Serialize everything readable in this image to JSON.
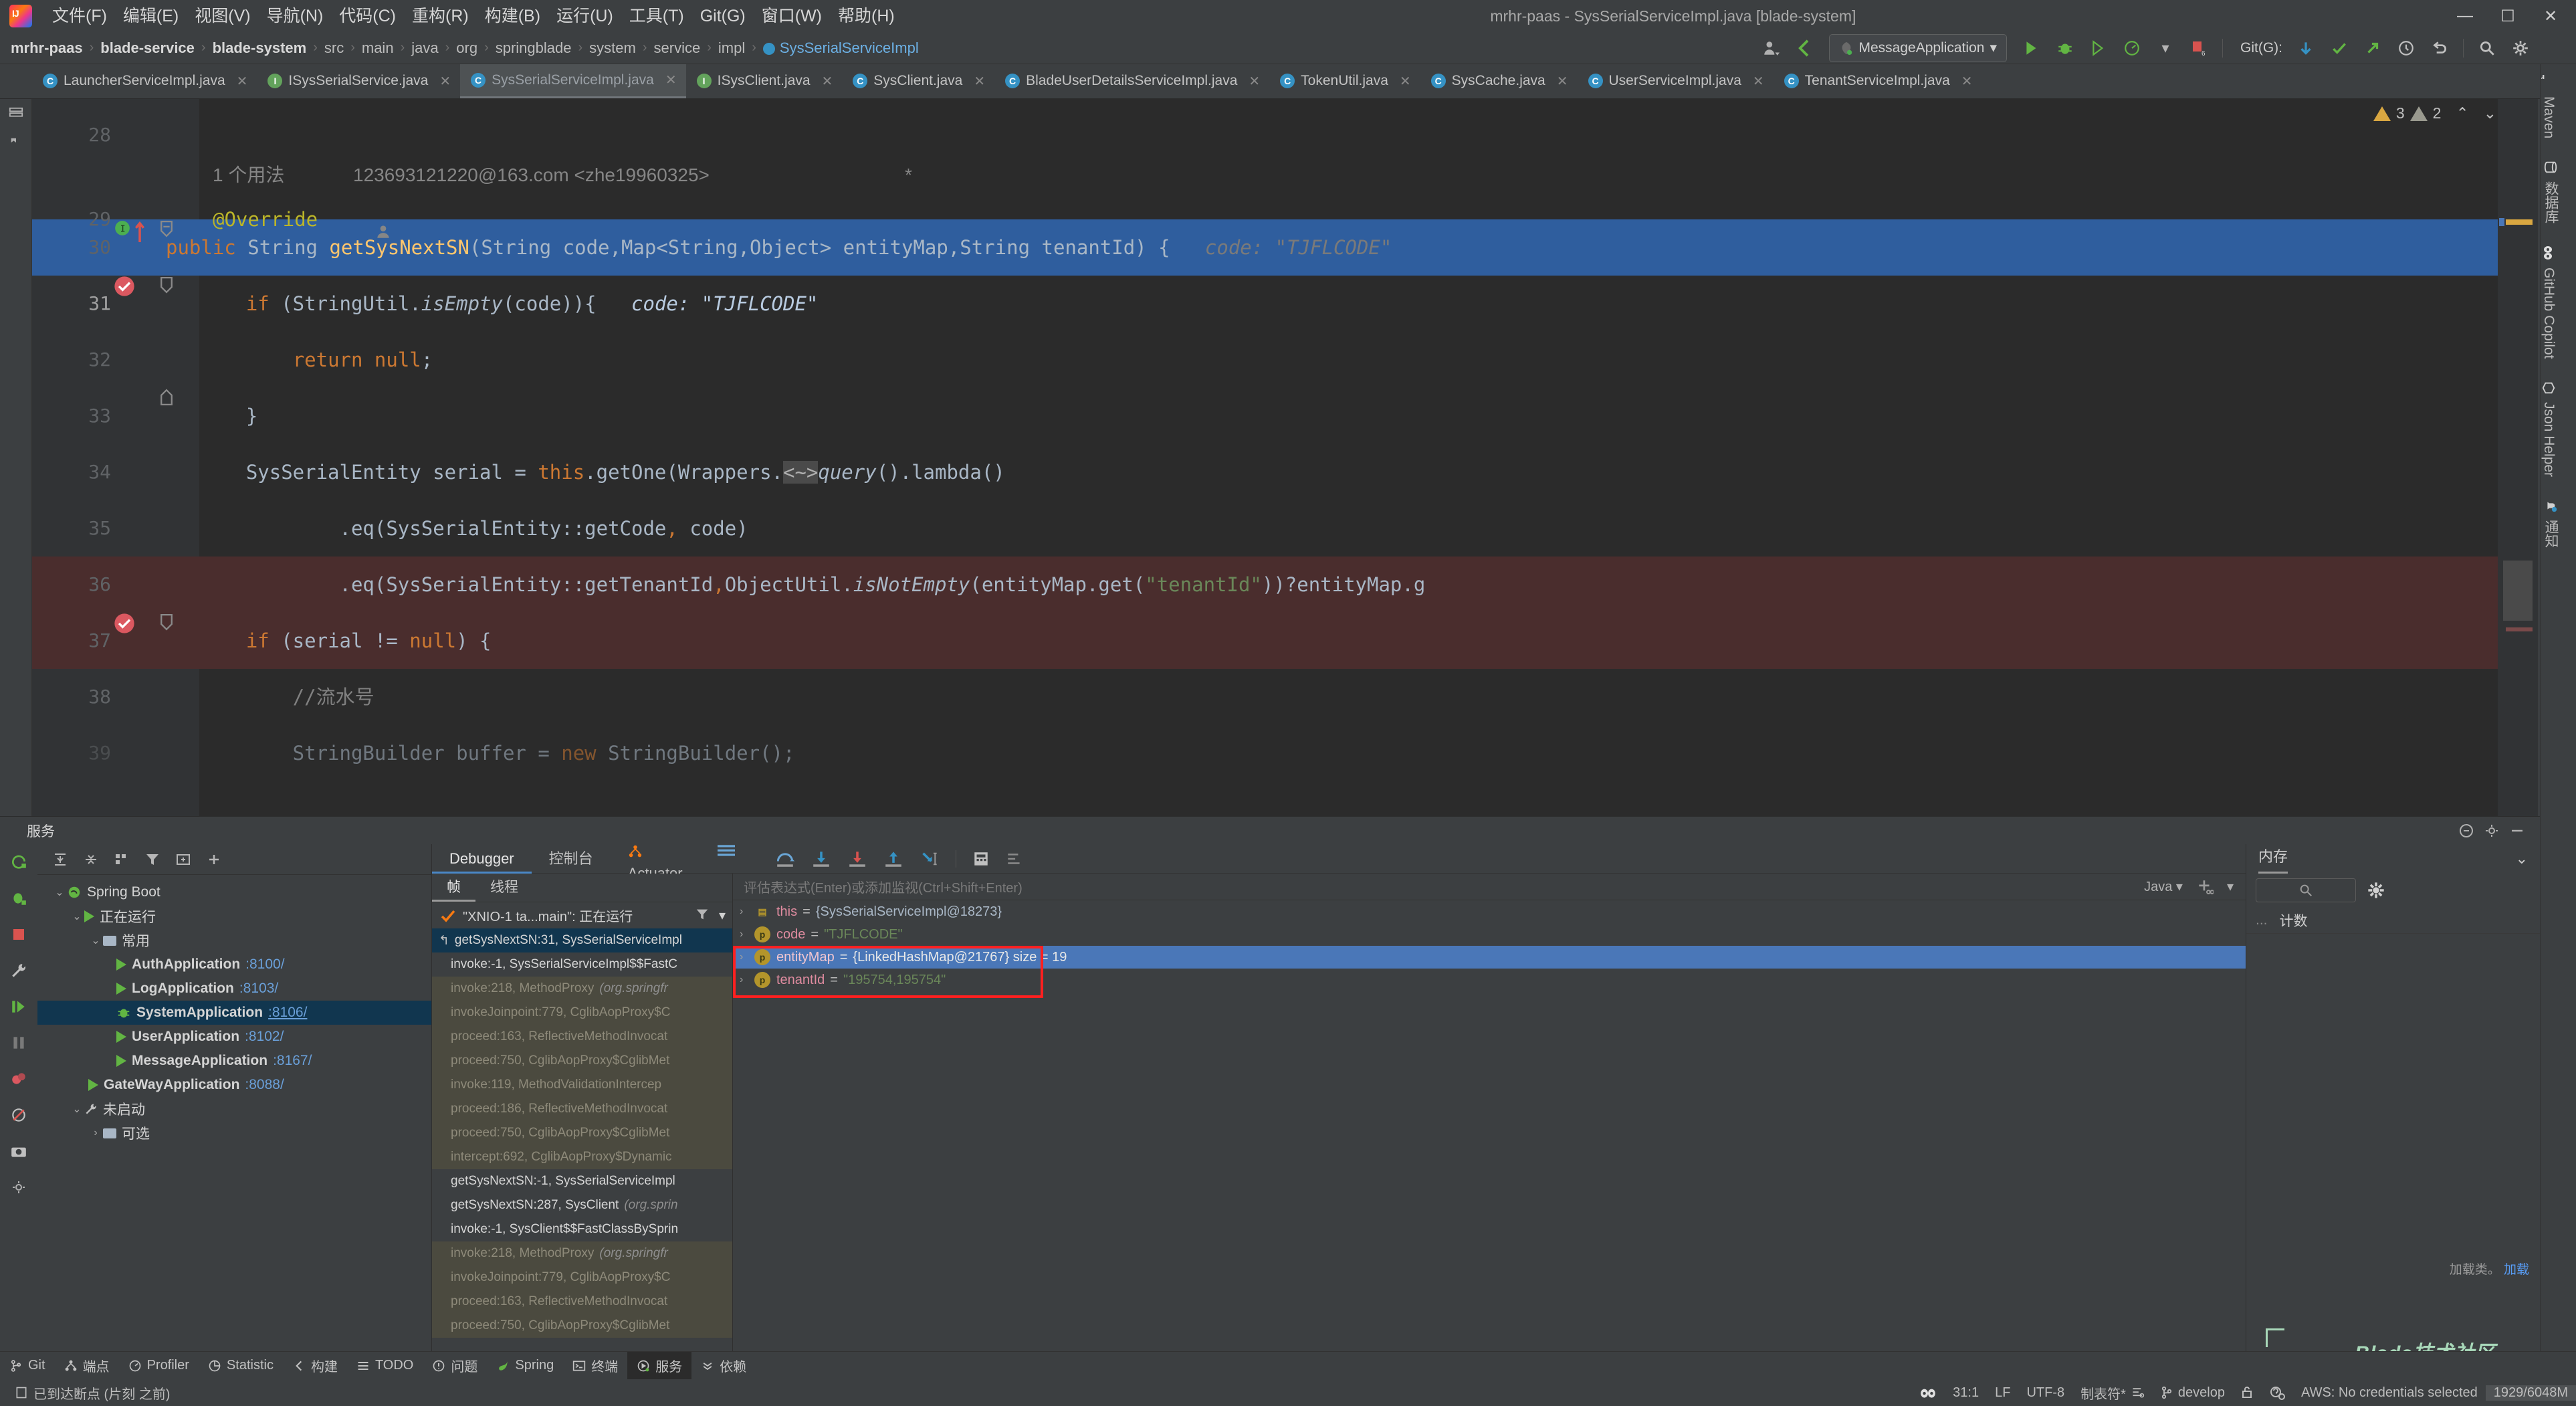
{
  "window": {
    "title": "mrhr-paas - SysSerialServiceImpl.java [blade-system]",
    "minimize": "—",
    "maximize": "☐",
    "close": "✕"
  },
  "menubar": {
    "logo": "ij-logo",
    "items": [
      "文件(F)",
      "编辑(E)",
      "视图(V)",
      "导航(N)",
      "代码(C)",
      "重构(R)",
      "构建(B)",
      "运行(U)",
      "工具(T)",
      "Git(G)",
      "窗口(W)",
      "帮助(H)"
    ]
  },
  "breadcrumb": {
    "items": [
      {
        "label": "mrhr-paas",
        "bold": true
      },
      {
        "label": "blade-service",
        "bold": true
      },
      {
        "label": "blade-system",
        "bold": true
      },
      {
        "label": "src",
        "bold": false
      },
      {
        "label": "main",
        "bold": false
      },
      {
        "label": "java",
        "bold": false
      },
      {
        "label": "org",
        "bold": false
      },
      {
        "label": "springblade",
        "bold": false
      },
      {
        "label": "system",
        "bold": false
      },
      {
        "label": "service",
        "bold": false
      },
      {
        "label": "impl",
        "bold": false
      },
      {
        "label": "SysSerialServiceImpl",
        "bold": false,
        "active": true
      }
    ],
    "separator": "›"
  },
  "toolbar": {
    "run_config": "MessageApplication",
    "git_label": "Git(G):",
    "breakpoint_count": "6"
  },
  "editor_tabs": [
    {
      "label": "LauncherServiceImpl.java",
      "kind": "C",
      "selected": false
    },
    {
      "label": "ISysSerialService.java",
      "kind": "I",
      "selected": false
    },
    {
      "label": "SysSerialServiceImpl.java",
      "kind": "C",
      "selected": true
    },
    {
      "label": "ISysClient.java",
      "kind": "I",
      "selected": false
    },
    {
      "label": "SysClient.java",
      "kind": "C",
      "selected": false
    },
    {
      "label": "BladeUserDetailsServiceImpl.java",
      "kind": "C",
      "selected": false
    },
    {
      "label": "TokenUtil.java",
      "kind": "C",
      "selected": false
    },
    {
      "label": "SysCache.java",
      "kind": "C",
      "selected": false
    },
    {
      "label": "UserServiceImpl.java",
      "kind": "C",
      "selected": false
    },
    {
      "label": "TenantServiceImpl.java",
      "kind": "C",
      "selected": false
    }
  ],
  "inspections": {
    "warn_count": "3",
    "weak_count": "2",
    "up": "⌃",
    "down": "⌄"
  },
  "code": {
    "lines": [
      {
        "num": "28",
        "text": ""
      },
      {
        "num": "",
        "usage": "1 个用法",
        "author": "123693121220@163.com <zhe19960325>",
        "trail": "*"
      },
      {
        "num": "29",
        "text": "@Override"
      },
      {
        "num": "30",
        "text": "public String getSysNextSN(String code,Map<String,Object> entityMap,String tenantId) {",
        "hint": "code:  \"TJFLCODE\""
      },
      {
        "num": "31",
        "text": "if (StringUtil.isEmpty(code)){",
        "hint": "code:  \"TJFLCODE\"",
        "highlight": "blue",
        "breakpoint": true
      },
      {
        "num": "32",
        "text": "return null;"
      },
      {
        "num": "33",
        "text": "}"
      },
      {
        "num": "34",
        "text": "SysSerialEntity serial = this.getOne(Wrappers.<~>query().lambda()"
      },
      {
        "num": "35",
        "text": ".eq(SysSerialEntity::getCode, code)"
      },
      {
        "num": "36",
        "text": ".eq(SysSerialEntity::getTenantId,ObjectUtil.isNotEmpty(entityMap.get(\"tenantId\"))?entityMap.g"
      },
      {
        "num": "37",
        "text": "if (serial != null) {",
        "highlight": "red",
        "breakpoint": true
      },
      {
        "num": "38",
        "text": "//流水号"
      },
      {
        "num": "39",
        "text": "StringBuilder buffer = new StringBuilder();"
      }
    ]
  },
  "services": {
    "header_title": "服务",
    "tree": [
      {
        "label": "Spring Boot",
        "depth": 0,
        "icon": "spring-icon",
        "expanded": true
      },
      {
        "label": "正在运行",
        "depth": 1,
        "icon": "run-icon",
        "expanded": true
      },
      {
        "label": "常用",
        "depth": 2,
        "icon": "folder-icon",
        "expanded": true
      },
      {
        "label": "AuthApplication",
        "port": ":8100/",
        "depth": 3,
        "icon": "run-icon"
      },
      {
        "label": "LogApplication",
        "port": ":8103/",
        "depth": 3,
        "icon": "run-icon"
      },
      {
        "label": "SystemApplication",
        "port": ":8106/",
        "depth": 3,
        "icon": "debug-icon",
        "selected": true
      },
      {
        "label": "UserApplication",
        "port": ":8102/",
        "depth": 3,
        "icon": "run-icon"
      },
      {
        "label": "MessageApplication",
        "port": ":8167/",
        "depth": 3,
        "icon": "run-icon"
      },
      {
        "label": "GateWayApplication",
        "port": ":8088/",
        "depth": 2,
        "icon": "run-icon"
      },
      {
        "label": "未启动",
        "depth": 1,
        "icon": "wrench-icon",
        "expanded": true
      },
      {
        "label": "可选",
        "depth": 2,
        "icon": "folder-icon",
        "expanded": false
      }
    ]
  },
  "debugger": {
    "tabs": [
      {
        "label": "Debugger",
        "selected": true
      },
      {
        "label": "控制台",
        "selected": false
      },
      {
        "label": "Actuator",
        "selected": false,
        "icon": "actuator-icon"
      }
    ],
    "frames_tabs": [
      {
        "label": "帧",
        "selected": true
      },
      {
        "label": "线程",
        "selected": false
      }
    ],
    "thread": "\"XNIO-1 ta...main\": 正在运行",
    "frames": [
      {
        "text": "getSysNextSN:31, SysSerialServiceImpl",
        "pkg": "",
        "selected": true,
        "lib": false
      },
      {
        "text": "invoke:-1, SysSerialServiceImpl$$FastC",
        "pkg": "",
        "selected": false,
        "lib": false
      },
      {
        "text": "invoke:218, MethodProxy",
        "pkg": "(org.springfr",
        "lib": true
      },
      {
        "text": "invokeJoinpoint:779, CglibAopProxy$C",
        "pkg": "",
        "lib": true
      },
      {
        "text": "proceed:163, ReflectiveMethodInvocat",
        "pkg": "",
        "lib": true
      },
      {
        "text": "proceed:750, CglibAopProxy$CglibMet",
        "pkg": "",
        "lib": true
      },
      {
        "text": "invoke:119, MethodValidationIntercep",
        "pkg": "",
        "lib": true
      },
      {
        "text": "proceed:186, ReflectiveMethodInvocat",
        "pkg": "",
        "lib": true
      },
      {
        "text": "proceed:750, CglibAopProxy$CglibMet",
        "pkg": "",
        "lib": true
      },
      {
        "text": "intercept:692, CglibAopProxy$Dynamic",
        "pkg": "",
        "lib": true
      },
      {
        "text": "getSysNextSN:-1, SysSerialServiceImpl",
        "pkg": "",
        "lib": false
      },
      {
        "text": "getSysNextSN:287, SysClient",
        "pkg": "(org.sprin",
        "lib": false
      },
      {
        "text": "invoke:-1, SysClient$$FastClassBySprin",
        "pkg": "",
        "lib": false
      },
      {
        "text": "invoke:218, MethodProxy",
        "pkg": "(org.springfr",
        "lib": true
      },
      {
        "text": "invokeJoinpoint:779, CglibAopProxy$C",
        "pkg": "",
        "lib": true
      },
      {
        "text": "proceed:163, ReflectiveMethodInvocat",
        "pkg": "",
        "lib": true
      },
      {
        "text": "proceed:750, CglibAopProxy$CglibMet",
        "pkg": "",
        "lib": true
      }
    ],
    "watch_placeholder": "评估表达式(Enter)或添加监视(Ctrl+Shift+Enter)",
    "lang_selector": "Java",
    "variables": [
      {
        "name": "this",
        "eq": "=",
        "value": "{SysSerialServiceImpl@18273}",
        "vtype": "obj",
        "selected": false
      },
      {
        "name": "code",
        "eq": "=",
        "value": "\"TJFLCODE\"",
        "vtype": "p",
        "string": true,
        "selected": false
      },
      {
        "name": "entityMap",
        "eq": "=",
        "value": "{LinkedHashMap@21767}  size = 19",
        "vtype": "p",
        "selected": true
      },
      {
        "name": "tenantId",
        "eq": "=",
        "value": "\"195754,195754\"",
        "vtype": "p",
        "string": true,
        "selected": false,
        "boxed": true
      }
    ]
  },
  "memory": {
    "title": "内存",
    "column": "计数",
    "footer_text": "加载类。",
    "footer_link": "加载"
  },
  "bottom_tools": [
    {
      "label": "Git",
      "icon": "git-icon",
      "selected": false
    },
    {
      "label": "端点",
      "icon": "endpoints-icon",
      "selected": false
    },
    {
      "label": "Profiler",
      "icon": "profiler-icon",
      "selected": false
    },
    {
      "label": "Statistic",
      "icon": "statistic-icon",
      "selected": false
    },
    {
      "label": "构建",
      "icon": "build-icon",
      "selected": false
    },
    {
      "label": "TODO",
      "icon": "todo-icon",
      "selected": false
    },
    {
      "label": "问题",
      "icon": "problems-icon",
      "selected": false
    },
    {
      "label": "Spring",
      "icon": "spring-icon",
      "selected": false
    },
    {
      "label": "终端",
      "icon": "terminal-icon",
      "selected": false
    },
    {
      "label": "服务",
      "icon": "services-icon",
      "selected": true
    },
    {
      "label": "依赖",
      "icon": "dependencies-icon",
      "selected": false
    }
  ],
  "statusbar": {
    "message": "已到达断点 (片刻 之前)",
    "caret": "31:1",
    "line_sep": "LF",
    "encoding": "UTF-8",
    "indent": "制表符*",
    "branch": "develop",
    "aws": "AWS: No credentials selected",
    "memory": "1929/6048M"
  },
  "right_strip": [
    {
      "label": "Maven",
      "icon": "maven-icon"
    },
    {
      "label": "数据库",
      "icon": "database-icon"
    },
    {
      "label": "GitHub Copilot",
      "icon": "copilot-icon"
    },
    {
      "label": "Json Helper",
      "icon": "json-icon"
    },
    {
      "label": "通知",
      "icon": "notification-icon"
    }
  ],
  "watermark": "Blade技术社区"
}
